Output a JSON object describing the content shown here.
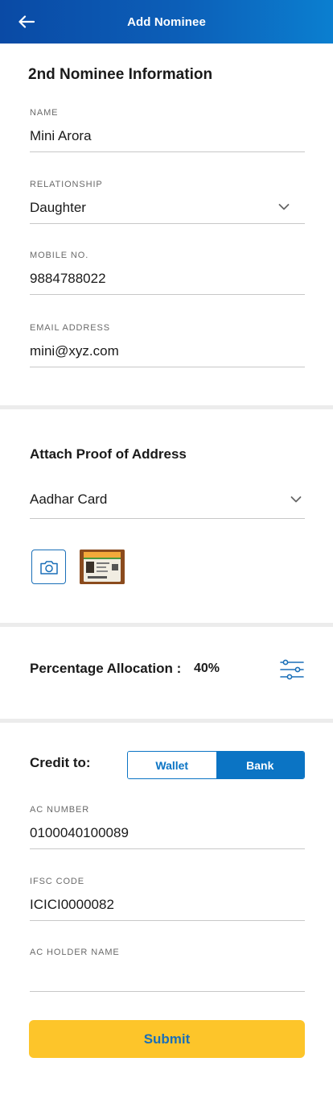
{
  "header": {
    "title": "Add Nominee",
    "back_icon": "arrow-left-icon"
  },
  "nominee": {
    "title": "2nd Nominee Information",
    "name": {
      "label": "NAME",
      "value": "Mini Arora"
    },
    "relationship": {
      "label": "RELATIONSHIP",
      "value": "Daughter"
    },
    "mobile": {
      "label": "MOBILE NO.",
      "value": "9884788022"
    },
    "email": {
      "label": "EMAIL ADDRESS",
      "value": "mini@xyz.com"
    }
  },
  "proof": {
    "title": "Attach Proof of Address",
    "document_type": "Aadhar Card",
    "camera_icon": "camera-icon"
  },
  "allocation": {
    "label": "Percentage Allocation :",
    "value": "40%",
    "icon": "sliders-icon"
  },
  "credit": {
    "label": "Credit to:",
    "options": [
      "Wallet",
      "Bank"
    ],
    "selected": "Bank",
    "ac_number": {
      "label": "AC NUMBER",
      "value": "0100040100089"
    },
    "ifsc": {
      "label": "IFSC CODE",
      "value": "ICICI0000082"
    },
    "holder": {
      "label": "AC HOLDER NAME",
      "value": ""
    }
  },
  "submit_label": "Submit",
  "colors": {
    "header_start": "#0a4aa5",
    "header_end": "#0b7fd0",
    "accent": "#0b74c4",
    "submit_bg": "#fdc52a"
  }
}
